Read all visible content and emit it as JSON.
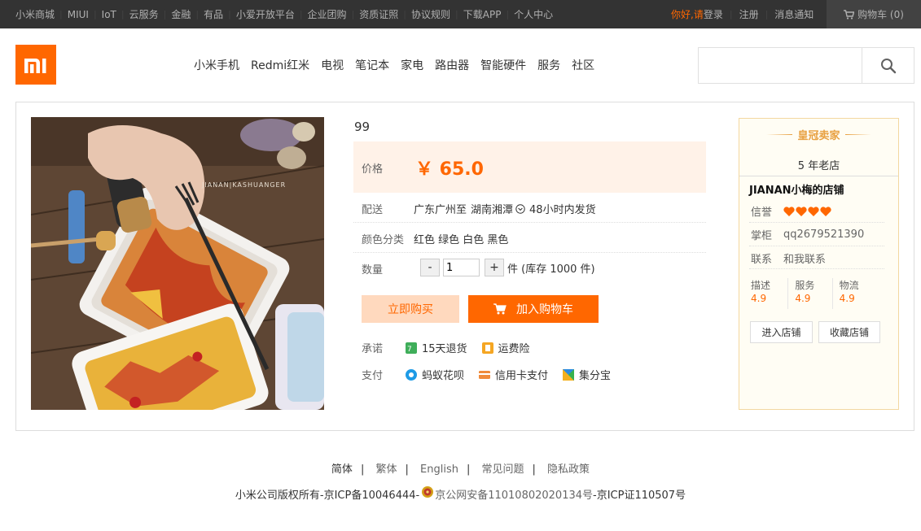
{
  "topbar": {
    "links": [
      "小米商城",
      "MIUI",
      "IoT",
      "云服务",
      "金融",
      "有品",
      "小爱开放平台",
      "企业团购",
      "资质证照",
      "协议规则",
      "下载APP",
      "个人中心"
    ],
    "greeting": "你好,请",
    "login": "登录",
    "register": "注册",
    "notice": "消息通知",
    "cart_label": "购物车 (0)"
  },
  "header": {
    "nav": [
      "小米手机",
      "Redmi红米",
      "电视",
      "笔记本",
      "家电",
      "路由器",
      "智能硬件",
      "服务",
      "社区"
    ],
    "search_placeholder": ""
  },
  "product": {
    "name": "99",
    "price_label": "价格",
    "price": "￥ 65.0",
    "delivery_label": "配送",
    "delivery_from": "广东广州至",
    "delivery_to": "湖南湘潭",
    "delivery_time": "48小时内发货",
    "color_label": "颜色分类",
    "colors": "红色 绿色 白色 黑色",
    "qty_label": "数量",
    "qty_minus": "-",
    "qty_value": "1",
    "qty_plus": "+",
    "stock": "件 (库存  1000 件)",
    "buy_now": "立即购买",
    "add_cart": "加入购物车",
    "promise_label": "承诺",
    "promise_1": "15天退货",
    "promise_2": "运费险",
    "pay_label": "支付",
    "pay_1": "蚂蚁花呗",
    "pay_2": "信用卡支付",
    "pay_3": "集分宝",
    "image_watermark": "JIANAN|KASHUANGER"
  },
  "shop": {
    "badge": "皇冠卖家",
    "years": "5 年老店",
    "name": "JIANAN小梅的店铺",
    "credit_label": "信誉",
    "credit_hearts": 4,
    "owner_label": "掌柜",
    "owner": "qq2679521390",
    "contact_label": "联系",
    "contact": "和我联系",
    "scores": [
      {
        "label": "描述",
        "value": "4.9"
      },
      {
        "label": "服务",
        "value": "4.9"
      },
      {
        "label": "物流",
        "value": "4.9"
      }
    ],
    "enter": "进入店铺",
    "favorite": "收藏店铺"
  },
  "footer": {
    "links": [
      "简体",
      "繁体",
      "English",
      "常见问题",
      "隐私政策"
    ],
    "copyright_1": "小米公司版权所有-京ICP备10046444-",
    "copyright_2": "京公网安备11010802020134号",
    "copyright_3": " -京ICP证110507号"
  },
  "colors": {
    "accent": "#ff6700",
    "topbar": "#333333"
  }
}
